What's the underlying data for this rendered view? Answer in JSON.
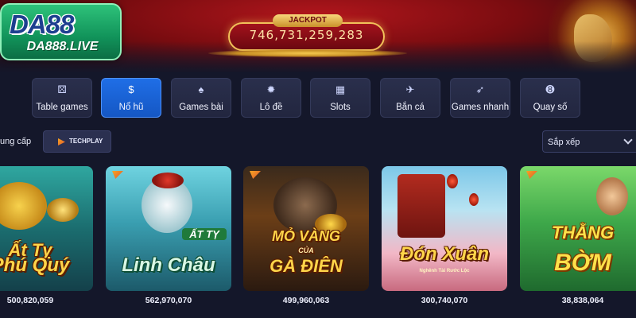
{
  "brand": {
    "logo_text": "DA88",
    "domain": "DA888.LIVE",
    "color": "#11935a"
  },
  "jackpot": {
    "label": "JACKPOT",
    "value": "746,731,259,283"
  },
  "categories": [
    {
      "label": "Table games",
      "icon": "dice-icon",
      "active": false
    },
    {
      "label": "Nổ hũ",
      "icon": "money-bag-icon",
      "active": true
    },
    {
      "label": "Games bài",
      "icon": "cards-icon",
      "active": false
    },
    {
      "label": "Lô đề",
      "icon": "lottery-wheel-icon",
      "active": false
    },
    {
      "label": "Slots",
      "icon": "slot-machine-icon",
      "active": false
    },
    {
      "label": "Bắn cá",
      "icon": "fish-icon",
      "active": false
    },
    {
      "label": "Games nhanh",
      "icon": "rocket-icon",
      "active": false
    },
    {
      "label": "Quay số",
      "icon": "ball-8-icon",
      "active": false
    }
  ],
  "provider": {
    "label_text": "ung cấp",
    "selected": "TECHPLAY"
  },
  "sort": {
    "label": "Sắp xếp"
  },
  "games": [
    {
      "title": "Phú Quý",
      "title_top": "Ất Tỵ",
      "jackpot": "500,820,059"
    },
    {
      "title": "Linh Châu",
      "title_top": "ẤT TỴ",
      "jackpot": "562,970,070"
    },
    {
      "title": "GÀ ĐIÊN",
      "title_top": "MỎ VÀNG",
      "title_mid": "CỦA",
      "jackpot": "499,960,063"
    },
    {
      "title": "Đón Xuân",
      "subtitle": "Nghênh Tài Rước Lộc",
      "jackpot": "300,740,070"
    },
    {
      "title": "BỜM",
      "title_top": "THẰNG",
      "jackpot": "38,838,064"
    }
  ],
  "accent_color": "#1f6ee6"
}
